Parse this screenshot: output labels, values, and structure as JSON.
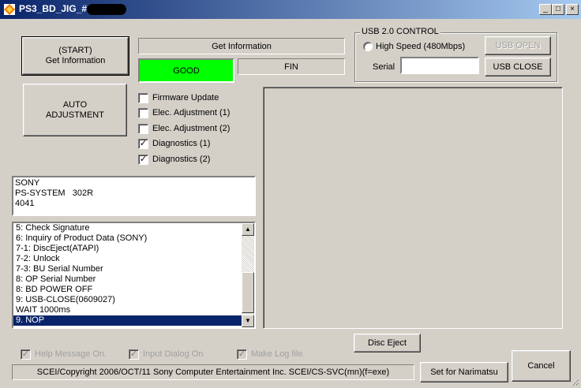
{
  "window": {
    "title": "PS3_BD_JIG_#",
    "minimize": "_",
    "maximize": "□",
    "close": "×"
  },
  "buttons": {
    "start": "(START)\nGet Information",
    "auto_adjust": "AUTO\nADJUSTMENT",
    "usb_open": "USB OPEN",
    "usb_close": "USB CLOSE",
    "disc_eject": "Disc Eject",
    "set_for": "Set for Narimatsu",
    "cancel": "Cancel"
  },
  "status": {
    "operation": "Get Information",
    "result": "GOOD",
    "result_color": "#00ff00",
    "phase": "FIN"
  },
  "usb": {
    "group_label": "USB 2.0 CONTROL",
    "high_speed_label": "High Speed (480Mbps)",
    "serial_label": "Serial",
    "serial_value": ""
  },
  "tasks": [
    {
      "label": "Firmware Update",
      "checked": false
    },
    {
      "label": "Elec. Adjustment (1)",
      "checked": false
    },
    {
      "label": "Elec. Adjustment (2)",
      "checked": false
    },
    {
      "label": "Diagnostics (1)",
      "checked": true
    },
    {
      "label": "Diagnostics (2)",
      "checked": true
    }
  ],
  "device_info": "SONY\nPS-SYSTEM   302R\n4041",
  "log_items": [
    "5: Check Signature",
    "6: Inquiry of Product Data (SONY)",
    "7-1: DiscEject(ATAPI)",
    "7-2: Unlock",
    "7-3: BU Serial Number",
    "8: OP Serial Number",
    "8: BD POWER OFF",
    "9: USB-CLOSE(0609027)",
    "WAIT 1000ms",
    "9. NOP"
  ],
  "log_selected_index": 9,
  "options": [
    {
      "label": "Help Message On.",
      "checked": true
    },
    {
      "label": "Input Dialog On",
      "checked": true
    },
    {
      "label": "Make Log file.",
      "checked": true
    }
  ],
  "statusbar_text": "SCEI/Copyright 2006/OCT/11 Sony Computer Entertainment Inc.  SCEI/CS-SVC(mn)(f=exe)",
  "icons": {
    "app": "app-diamond-icon",
    "check": "✓",
    "scroll_up": "▲",
    "scroll_down": "▼"
  }
}
